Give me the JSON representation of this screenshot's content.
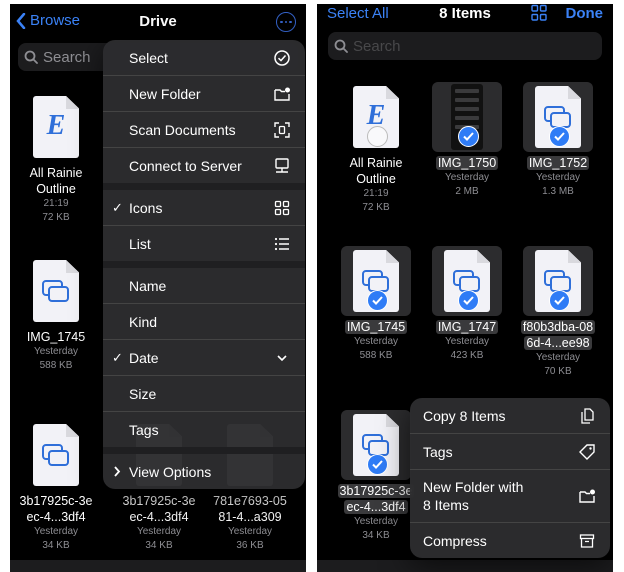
{
  "left": {
    "nav": {
      "back_label": "Browse",
      "title": "Drive",
      "more_icon": "ellipsis-circle-icon"
    },
    "search": {
      "placeholder": "Search"
    },
    "files": [
      {
        "name": "All Rainie Outline",
        "line1": "All Rainie",
        "line2": "Outline",
        "date": "21:19",
        "size": "72 KB",
        "icon": "document-E-icon"
      },
      {
        "name": "IMG_1745",
        "line1": "IMG_1745",
        "line2": "",
        "date": "Yesterday",
        "size": "588 KB",
        "icon": "image-stack-icon"
      },
      {
        "name": "3b17925c-3eec-4...3df4",
        "line1": "3b17925c-3e",
        "line2": "ec-4...3df4",
        "date": "Yesterday",
        "size": "34 KB",
        "icon": "image-stack-icon"
      },
      {
        "name": "3b17925c-3eec-4...3df4",
        "line1": "3b17925c-3e",
        "line2": "ec-4...3df4",
        "date": "Yesterday",
        "size": "34 KB",
        "icon": "image-stack-icon"
      },
      {
        "name": "781e7693-0581-4...a309",
        "line1": "781e7693-05",
        "line2": "81-4...a309",
        "date": "Yesterday",
        "size": "36 KB",
        "icon": "image-stack-icon"
      }
    ],
    "menu": {
      "group1": [
        {
          "label": "Select",
          "icon": "checkmark-circle-icon"
        },
        {
          "label": "New Folder",
          "icon": "folder-badge-plus-icon"
        },
        {
          "label": "Scan Documents",
          "icon": "doc-viewfinder-icon"
        },
        {
          "label": "Connect to Server",
          "icon": "desktop-computer-icon"
        }
      ],
      "group2": [
        {
          "label": "Icons",
          "checked": "✓",
          "icon": "grid-icon"
        },
        {
          "label": "List",
          "checked": "",
          "icon": "list-icon"
        }
      ],
      "group3": [
        {
          "label": "Name",
          "checked": ""
        },
        {
          "label": "Kind",
          "checked": ""
        },
        {
          "label": "Date",
          "checked": "✓",
          "icon": "chevron-down-icon"
        },
        {
          "label": "Size",
          "checked": ""
        },
        {
          "label": "Tags",
          "checked": ""
        }
      ],
      "view_options": {
        "label": "View Options",
        "icon": "chevron-right-icon"
      }
    }
  },
  "right": {
    "nav": {
      "select_all": "Select All",
      "title": "8 Items",
      "grid_icon": "grid-icon",
      "done": "Done"
    },
    "search": {
      "placeholder": "Search"
    },
    "files": [
      {
        "line1": "All Rainie",
        "line2": "Outline",
        "date": "21:19",
        "size": "72 KB",
        "selected": false
      },
      {
        "line1": "IMG_1750",
        "line2": "",
        "date": "Yesterday",
        "size": "2 MB",
        "selected": true
      },
      {
        "line1": "IMG_1752",
        "line2": "",
        "date": "Yesterday",
        "size": "1.3 MB",
        "selected": true
      },
      {
        "line1": "IMG_1745",
        "line2": "",
        "date": "Yesterday",
        "size": "588 KB",
        "selected": true
      },
      {
        "line1": "IMG_1747",
        "line2": "",
        "date": "Yesterday",
        "size": "423 KB",
        "selected": true
      },
      {
        "line1": "f80b3dba-08",
        "line2": "6d-4...ee98",
        "date": "Yesterday",
        "size": "70 KB",
        "selected": true
      },
      {
        "line1": "3b17925c-3e",
        "line2": "ec-4...3df4",
        "date": "Yesterday",
        "size": "34 KB",
        "selected": true
      }
    ],
    "menu": [
      {
        "label": "Copy 8 Items",
        "icon": "copy-doc-icon"
      },
      {
        "label": "Tags",
        "icon": "tag-icon"
      },
      {
        "label": "New Folder with 8 Items",
        "line1": "New Folder with",
        "line2": "8 Items",
        "icon": "folder-badge-plus-icon"
      },
      {
        "label": "Compress",
        "icon": "archive-box-icon"
      }
    ]
  },
  "colors": {
    "accent": "#3b82f6",
    "background": "#000000",
    "menu": "#2c2c2e"
  }
}
